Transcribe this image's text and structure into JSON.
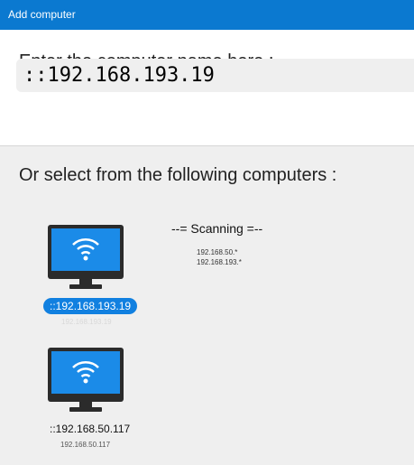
{
  "window": {
    "title": "Add computer"
  },
  "entry": {
    "prompt": "Enter the computer name here :",
    "value": "::192.168.193.19"
  },
  "selection": {
    "prompt": "Or select from the following computers :",
    "scanning_label": "--= Scanning =--",
    "scan_ranges": [
      "192.168.50.*",
      "192.168.193.*"
    ],
    "computers": [
      {
        "name": "::192.168.193.19",
        "ip": "192.168.193.19",
        "selected": true
      },
      {
        "name": "::192.168.50.117",
        "ip": "192.168.50.117",
        "selected": false
      }
    ]
  },
  "colors": {
    "titlebar": "#0b79d0",
    "monitor_screen": "#1b8be8",
    "monitor_frame": "#2b2b2b",
    "selection": "#1180e0"
  },
  "icons": {
    "computer": "monitor-wifi-icon"
  }
}
